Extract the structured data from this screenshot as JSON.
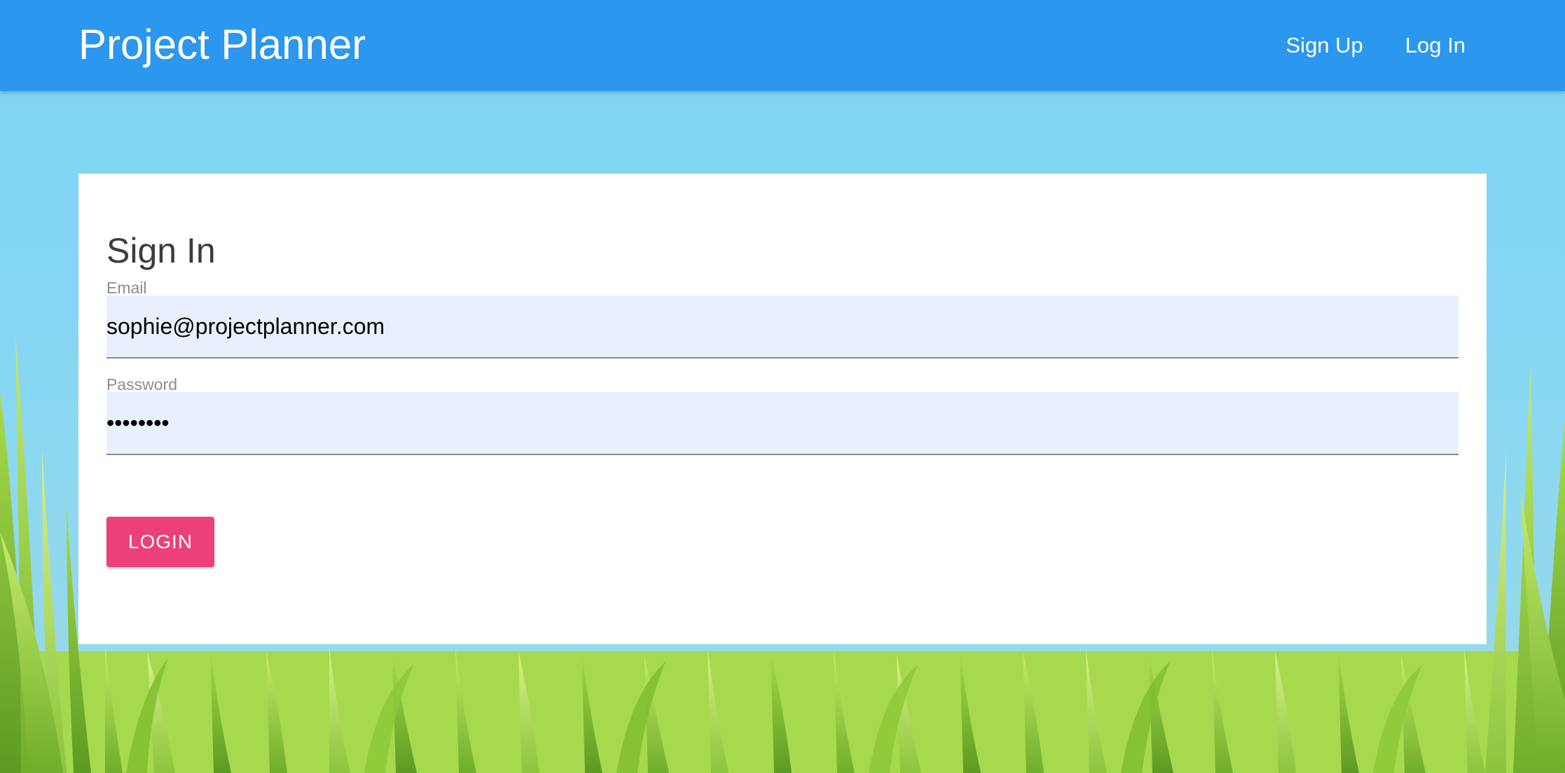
{
  "header": {
    "brand": "Project Planner",
    "nav": [
      {
        "label": "Sign Up"
      },
      {
        "label": "Log In"
      }
    ],
    "background_color": "#2b97ee"
  },
  "form": {
    "title": "Sign In",
    "email_label": "Email",
    "email_value": "sophie@projectplanner.com",
    "password_label": "Password",
    "password_value": "••••••••",
    "submit_label": "LOGIN",
    "submit_color": "#ec407a",
    "input_background": "#e8f0fc"
  },
  "background": {
    "sky_color": "#84d6f4",
    "grass_color": "#9ed34a"
  }
}
